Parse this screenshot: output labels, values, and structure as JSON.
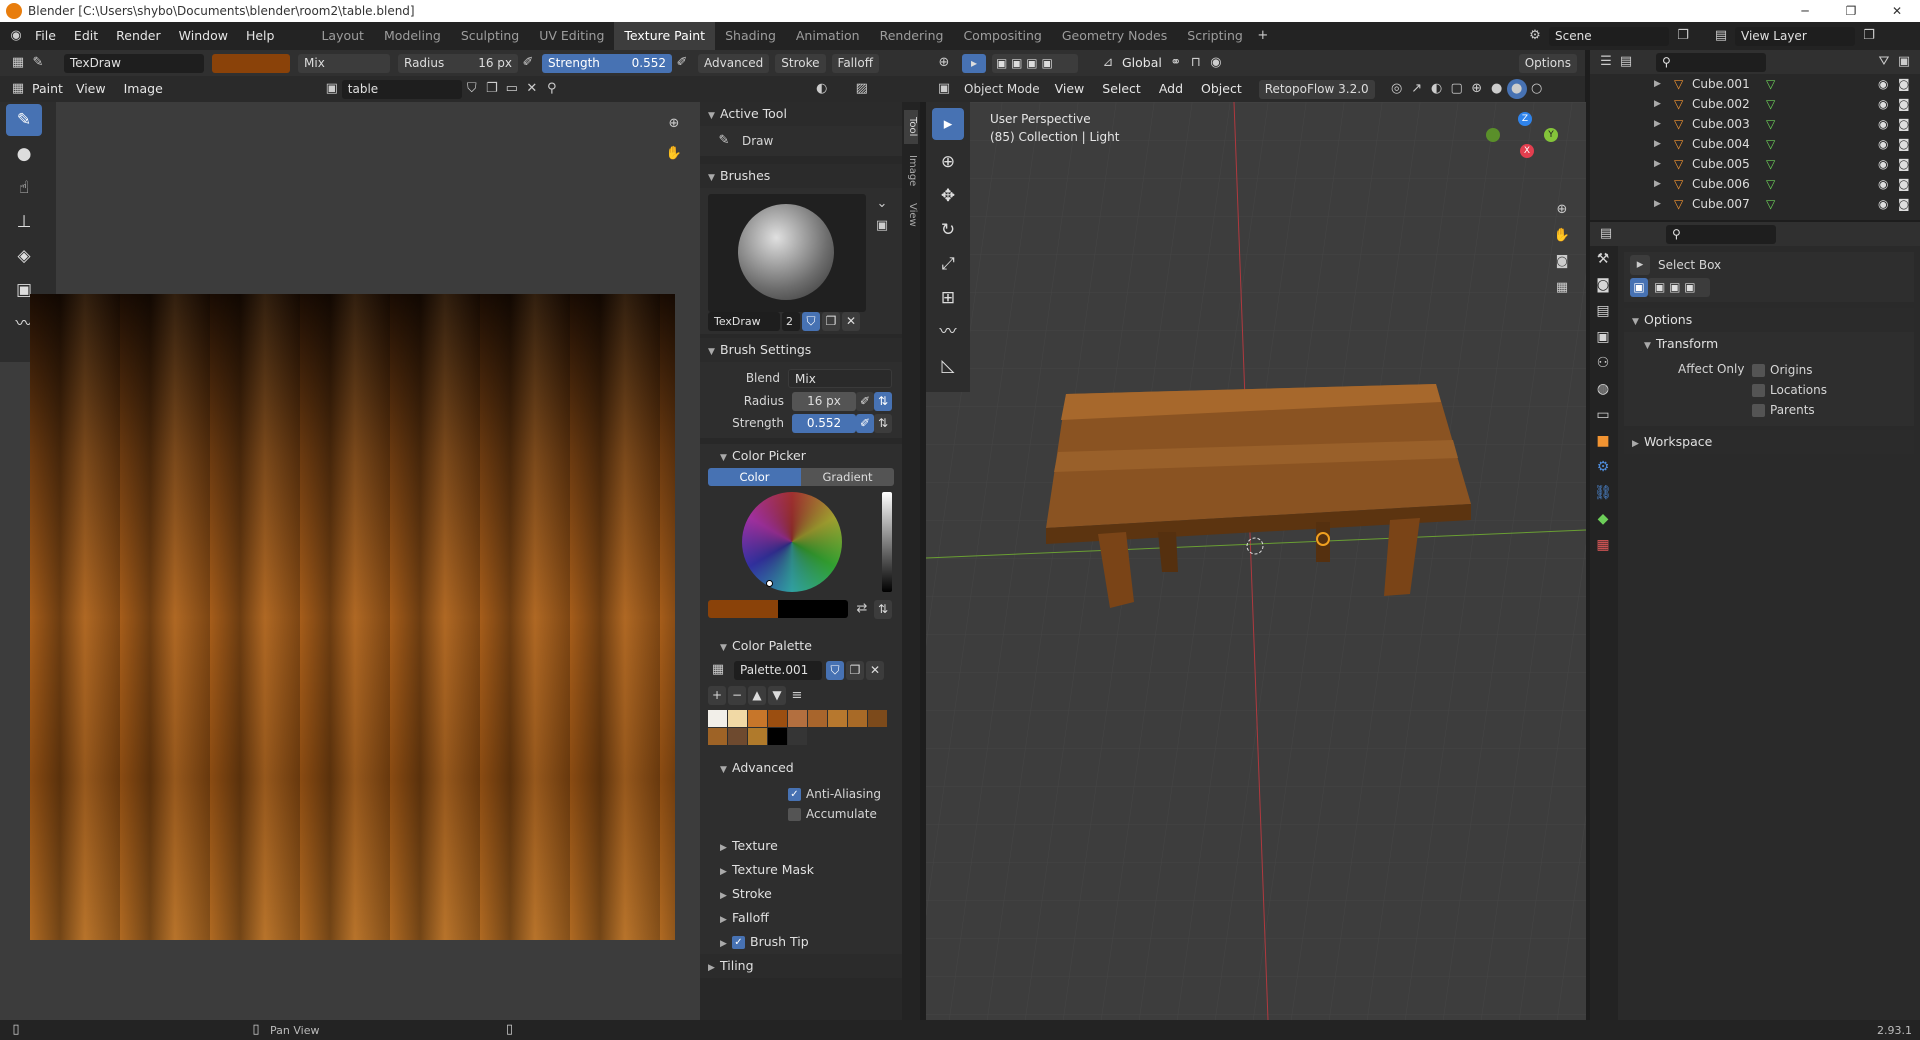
{
  "window": {
    "title": "Blender [C:\\Users\\shybo\\Documents\\blender\\room2\\table.blend]"
  },
  "menu": {
    "items": [
      "File",
      "Edit",
      "Render",
      "Window",
      "Help"
    ]
  },
  "workspaces": [
    "Layout",
    "Modeling",
    "Sculpting",
    "UV Editing",
    "Texture Paint",
    "Shading",
    "Animation",
    "Rendering",
    "Compositing",
    "Geometry Nodes",
    "Scripting"
  ],
  "active_workspace": "Texture Paint",
  "scene": {
    "label": "Scene",
    "view_layer": "View Layer"
  },
  "tool_header": {
    "brush_name": "TexDraw",
    "brush_color": "#8a4209",
    "blend": "Mix",
    "radius_label": "Radius",
    "radius_value": "16 px",
    "strength_label": "Strength",
    "strength_value": "0.552",
    "advanced": "Advanced",
    "stroke": "Stroke",
    "falloff": "Falloff"
  },
  "image_editor": {
    "mode": "Paint",
    "menu": [
      "View",
      "Image"
    ],
    "image_name": "table"
  },
  "sidebar_tabs": [
    "Tool",
    "Image",
    "View"
  ],
  "properties_panel": {
    "active_tool": {
      "title": "Active Tool",
      "tool": "Draw"
    },
    "brushes": {
      "title": "Brushes",
      "name": "TexDraw",
      "users": "2"
    },
    "brush_settings": {
      "title": "Brush Settings",
      "blend_label": "Blend",
      "blend_value": "Mix",
      "radius_label": "Radius",
      "radius_value": "16 px",
      "strength_label": "Strength",
      "strength_value": "0.552"
    },
    "color_picker": {
      "title": "Color Picker",
      "tab_color": "Color",
      "tab_gradient": "Gradient",
      "color": "#8a4209"
    },
    "color_palette": {
      "title": "Color Palette",
      "name": "Palette.001",
      "swatches": [
        "#f2efe9",
        "#f1d9a5",
        "#c7762a",
        "#9b4e10",
        "#b36f3f",
        "#a8652c",
        "#b7782e",
        "#a86a27",
        "#7c4a1b",
        "#9e6326",
        "#6e4a2f",
        "#b07a2b",
        "#000000",
        "#353535"
      ]
    },
    "advanced": {
      "title": "Advanced",
      "anti_aliasing": "Anti-Aliasing",
      "accumulate": "Accumulate"
    },
    "collapsed": [
      "Texture",
      "Texture Mask",
      "Stroke",
      "Falloff",
      "Brush Tip"
    ],
    "tiling": "Tiling"
  },
  "viewport": {
    "mode": "Object Mode",
    "menu": [
      "View",
      "Select",
      "Add",
      "Object"
    ],
    "addon": "RetopoFlow 3.2.0",
    "orientation": "Global",
    "options": "Options",
    "overlay_line1": "User Perspective",
    "overlay_line2": "(85) Collection | Light",
    "gizmo": {
      "z": "Z",
      "y": "Y",
      "x": "X"
    }
  },
  "outliner": {
    "items": [
      "Cube.001",
      "Cube.002",
      "Cube.003",
      "Cube.004",
      "Cube.005",
      "Cube.006",
      "Cube.007"
    ]
  },
  "props_editor": {
    "tool": "Select Box",
    "options": "Options",
    "transform": "Transform",
    "affect_only": "Affect Only",
    "origins": "Origins",
    "locations": "Locations",
    "parents": "Parents",
    "workspace": "Workspace"
  },
  "statusbar": {
    "hint": "Pan View",
    "version": "2.93.1"
  }
}
